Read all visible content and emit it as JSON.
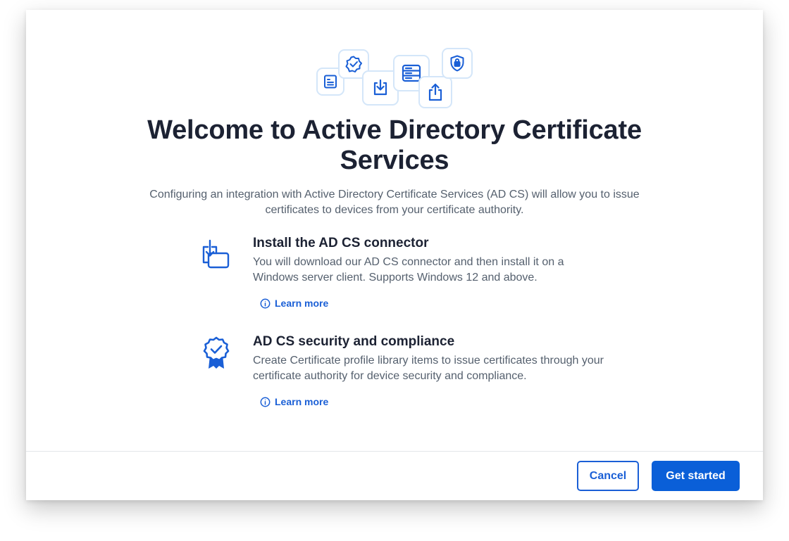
{
  "dialog": {
    "title_line1": "Welcome to Active Directory Certificate",
    "title_line2": "Services",
    "intro": "Configuring an integration with Active Directory Certificate Services (AD CS) will allow you to issue certificates to devices from your certificate authority."
  },
  "hero_icons": [
    "document-icon",
    "verified-badge-icon",
    "download-icon",
    "server-icon",
    "share-icon",
    "lock-shield-icon"
  ],
  "features": [
    {
      "icon": "download-connector-icon",
      "title": "Install the AD CS connector",
      "description": "You will download our AD CS connector and then install it on a Windows server client. Supports Windows 12 and above.",
      "link_label": "Learn more"
    },
    {
      "icon": "certificate-ribbon-icon",
      "title": "AD CS security and compliance",
      "description": "Create Certificate profile library items to issue certificates through your certificate authority for device security and compliance.",
      "link_label": "Learn more"
    }
  ],
  "footer": {
    "cancel_label": "Cancel",
    "primary_label": "Get started"
  },
  "colors": {
    "accent": "#0a5fd8",
    "title": "#1c2233",
    "body_text": "#55606e",
    "tile_border": "#d4e6f9"
  }
}
